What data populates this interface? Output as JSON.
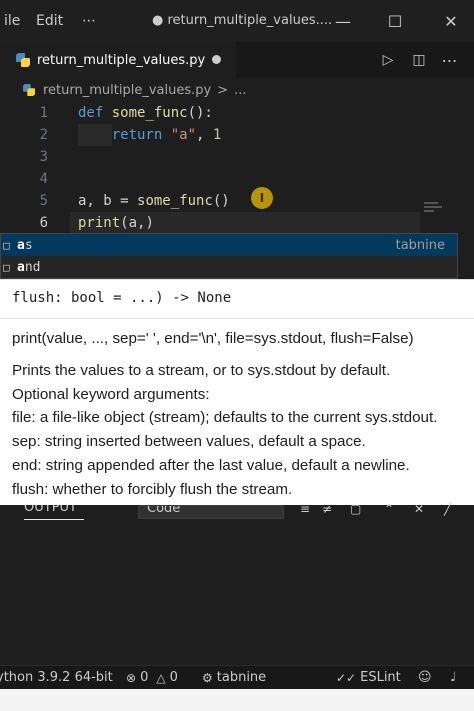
{
  "titlebar": {
    "menu": [
      "ile",
      "Edit",
      "⋯"
    ],
    "window_title": "● return_multiple_values....",
    "minimize": "—",
    "maximize": "☐",
    "close": "✕"
  },
  "tab": {
    "label": "return_multiple_values.py",
    "icon": "python-file-icon"
  },
  "actions": {
    "run": "▷",
    "split": "◫",
    "more": "⋯"
  },
  "breadcrumb": {
    "file": "return_multiple_values.py",
    "separator": ">",
    "more": "..."
  },
  "editor": {
    "lines": [
      {
        "number": "1",
        "tokens": [
          [
            "kw",
            "def "
          ],
          [
            "fn",
            "some_func"
          ],
          [
            "plain",
            "():"
          ]
        ]
      },
      {
        "number": "2",
        "tokens": [
          [
            "plain",
            "    "
          ],
          [
            "kw",
            "return "
          ],
          [
            "str",
            "\"a\""
          ],
          [
            "plain",
            ", "
          ],
          [
            "num",
            "1"
          ]
        ]
      },
      {
        "number": "3",
        "tokens": []
      },
      {
        "number": "4",
        "tokens": []
      },
      {
        "number": "5",
        "tokens": [
          [
            "plain",
            "a, b = "
          ],
          [
            "fn",
            "some_func"
          ],
          [
            "plain",
            "()"
          ]
        ]
      },
      {
        "number": "6",
        "tokens": [
          [
            "fn",
            "print"
          ],
          [
            "plain",
            "(a,)"
          ]
        ]
      }
    ],
    "active_line": "6"
  },
  "suggest": {
    "items": [
      {
        "match": "a",
        "rest": "s",
        "source": "tabnine"
      },
      {
        "match": "a",
        "rest": "nd",
        "source": ""
      }
    ]
  },
  "hover": {
    "signature_tail": "flush: bool = ...) -> None",
    "lines": [
      "print(value, ..., sep=' ', end='\\n', file=sys.stdout, flush=False)",
      "Prints the values to a stream, or to sys.stdout by default.",
      "Optional keyword arguments:",
      "file: a file-like object (stream); defaults to the current sys.stdout.",
      "sep: string inserted between values, default a space.",
      "end: string appended after the last value, default a newline.",
      "flush: whether to forcibly flush the stream."
    ]
  },
  "panel": {
    "tab_fragment": "OUTPUT",
    "select_value": "Code"
  },
  "statusbar": {
    "python": "ython 3.9.2 64-bit",
    "problems_errors": "0",
    "problems_warnings": "0",
    "tabnine": "tabnine",
    "eslint": "ESLint"
  }
}
